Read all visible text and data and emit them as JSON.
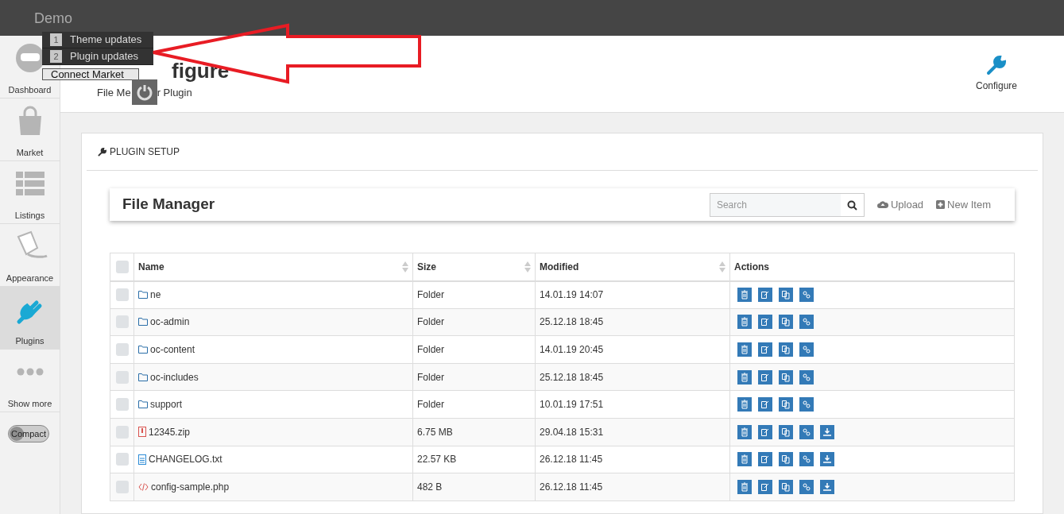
{
  "topbar": {
    "title": "Demo"
  },
  "sidebar": {
    "items": [
      {
        "kind": "dashboard",
        "label": "Dashboard",
        "selected": false
      },
      {
        "kind": "market",
        "label": "Market",
        "selected": false
      },
      {
        "kind": "listings",
        "label": "Listings",
        "selected": false
      },
      {
        "kind": "appearance",
        "label": "Appearance",
        "selected": false
      },
      {
        "kind": "plugins",
        "label": "Plugins",
        "selected": true
      },
      {
        "kind": "more",
        "label": "Show more",
        "selected": false
      }
    ],
    "compact": {
      "label": "Compact",
      "on": false
    }
  },
  "popup": {
    "items": [
      {
        "count": "1",
        "label": "Theme updates"
      },
      {
        "count": "2",
        "label": "Plugin updates"
      }
    ],
    "connect": "Connect Market"
  },
  "header": {
    "title": "figure",
    "subtitle_left": "File Me",
    "subtitle_right": "r Plugin",
    "action": "Configure"
  },
  "panel": {
    "title": "PLUGIN SETUP"
  },
  "file_manager": {
    "title": "File Manager",
    "search": {
      "placeholder": "Search"
    },
    "upload": "Upload",
    "new_item": "New Item"
  },
  "table": {
    "all_checked": false,
    "columns": [
      {
        "label": "Name",
        "sortable": true
      },
      {
        "label": "Size",
        "sortable": true
      },
      {
        "label": "Modified",
        "sortable": true
      },
      {
        "label": "Actions",
        "sortable": false
      }
    ],
    "rows": [
      {
        "kind": "folder",
        "name": "ne",
        "size": "Folder",
        "modified": "14.01.19 14:07",
        "checked": false,
        "download": false
      },
      {
        "kind": "folder",
        "name": "oc-admin",
        "size": "Folder",
        "modified": "25.12.18 18:45",
        "checked": false,
        "download": false
      },
      {
        "kind": "folder",
        "name": "oc-content",
        "size": "Folder",
        "modified": "14.01.19 20:45",
        "checked": false,
        "download": false
      },
      {
        "kind": "folder",
        "name": "oc-includes",
        "size": "Folder",
        "modified": "25.12.18 18:45",
        "checked": false,
        "download": false
      },
      {
        "kind": "folder",
        "name": "support",
        "size": "Folder",
        "modified": "10.01.19 17:51",
        "checked": false,
        "download": false
      },
      {
        "kind": "zip",
        "name": "12345.zip",
        "size": "6.75 MB",
        "modified": "29.04.18 15:31",
        "checked": false,
        "download": true
      },
      {
        "kind": "text",
        "name": "CHANGELOG.txt",
        "size": "22.57 KB",
        "modified": "26.12.18 11:45",
        "checked": false,
        "download": true
      },
      {
        "kind": "code",
        "name": "config-sample.php",
        "size": "482 B",
        "modified": "26.12.18 11:45",
        "checked": false,
        "download": true
      }
    ]
  }
}
